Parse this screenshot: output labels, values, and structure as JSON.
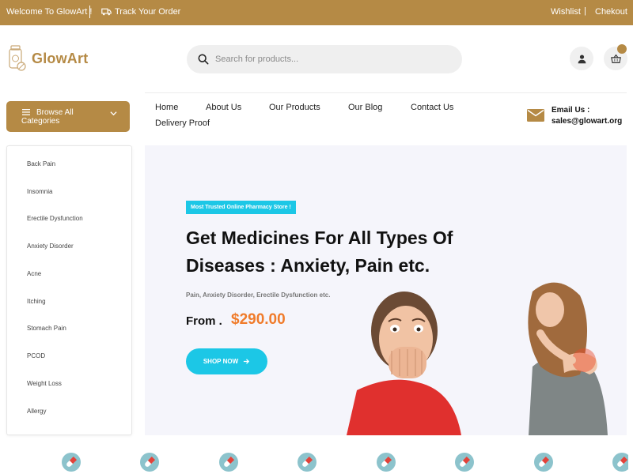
{
  "topbar": {
    "welcome": "Welcome To GlowArt !",
    "track": "Track Your Order",
    "wishlist": "Wishlist",
    "separator": "|",
    "checkout": "Chekout"
  },
  "header": {
    "brand": "GlowArt",
    "search_placeholder": "Search for products..."
  },
  "browse": {
    "label": "Browse All Categories"
  },
  "nav": {
    "items": [
      "Home",
      "About Us",
      "Our Products",
      "Our Blog",
      "Contact Us",
      "Delivery Proof"
    ]
  },
  "contact": {
    "label": "Email Us :",
    "email": "sales@glowart.org"
  },
  "categories": [
    "Back Pain",
    "Insomnia",
    "Erectile Dysfunction",
    "Anxiety Disorder",
    "Acne",
    "Itching",
    "Stomach Pain",
    "PCOD",
    "Weight Loss",
    "Allergy"
  ],
  "hero": {
    "badge": "Most Trusted Online Pharmacy Store !",
    "title_line1": "Get Medicines For All Types Of",
    "title_line2": "Diseases : Anxiety, Pain etc.",
    "subtitle": "Pain, Anxiety Disorder, Erectile Dysfunction etc.",
    "from_label": "From .",
    "price": "$290.00",
    "cta": "SHOP NOW"
  },
  "colors": {
    "brand": "#b58a45",
    "accent": "#1cc7e6",
    "price": "#f07b2a"
  }
}
